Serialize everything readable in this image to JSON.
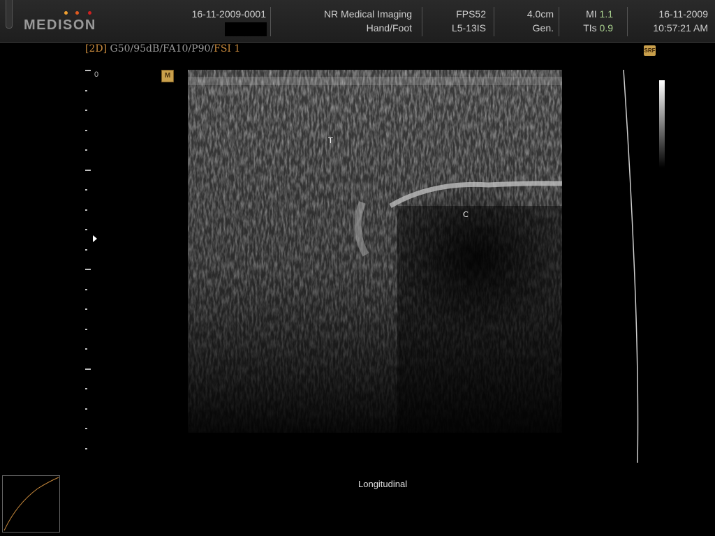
{
  "header": {
    "brand": "MEDISON",
    "patient_id": "16-11-2009-0001",
    "institution": "NR Medical Imaging",
    "study": "Hand/Foot",
    "fps": "FPS52",
    "probe": "L5-13IS",
    "depth": "4.0cm",
    "mode": "Gen.",
    "mi_label": "MI",
    "mi_value": "1.1",
    "tis_label": "TIs",
    "tis_value": "0.9",
    "date": "16-11-2009",
    "time": "10:57:21 AM"
  },
  "preset": {
    "mode": "[2D]",
    "params": "G50/95dB/FA10/P90/",
    "fsi": "FSI 1"
  },
  "scan": {
    "depth_zero": "0",
    "label_t": "T",
    "label_c": "C",
    "caption": "Longitudinal"
  },
  "icons": {
    "m_icon": "M",
    "srf_icon": "SRF"
  },
  "colors": {
    "accent_orange": "#c98a3c",
    "value_green": "#a9d18e",
    "logo_dots": [
      "#f0a030",
      "#e05a20",
      "#d02020"
    ]
  }
}
